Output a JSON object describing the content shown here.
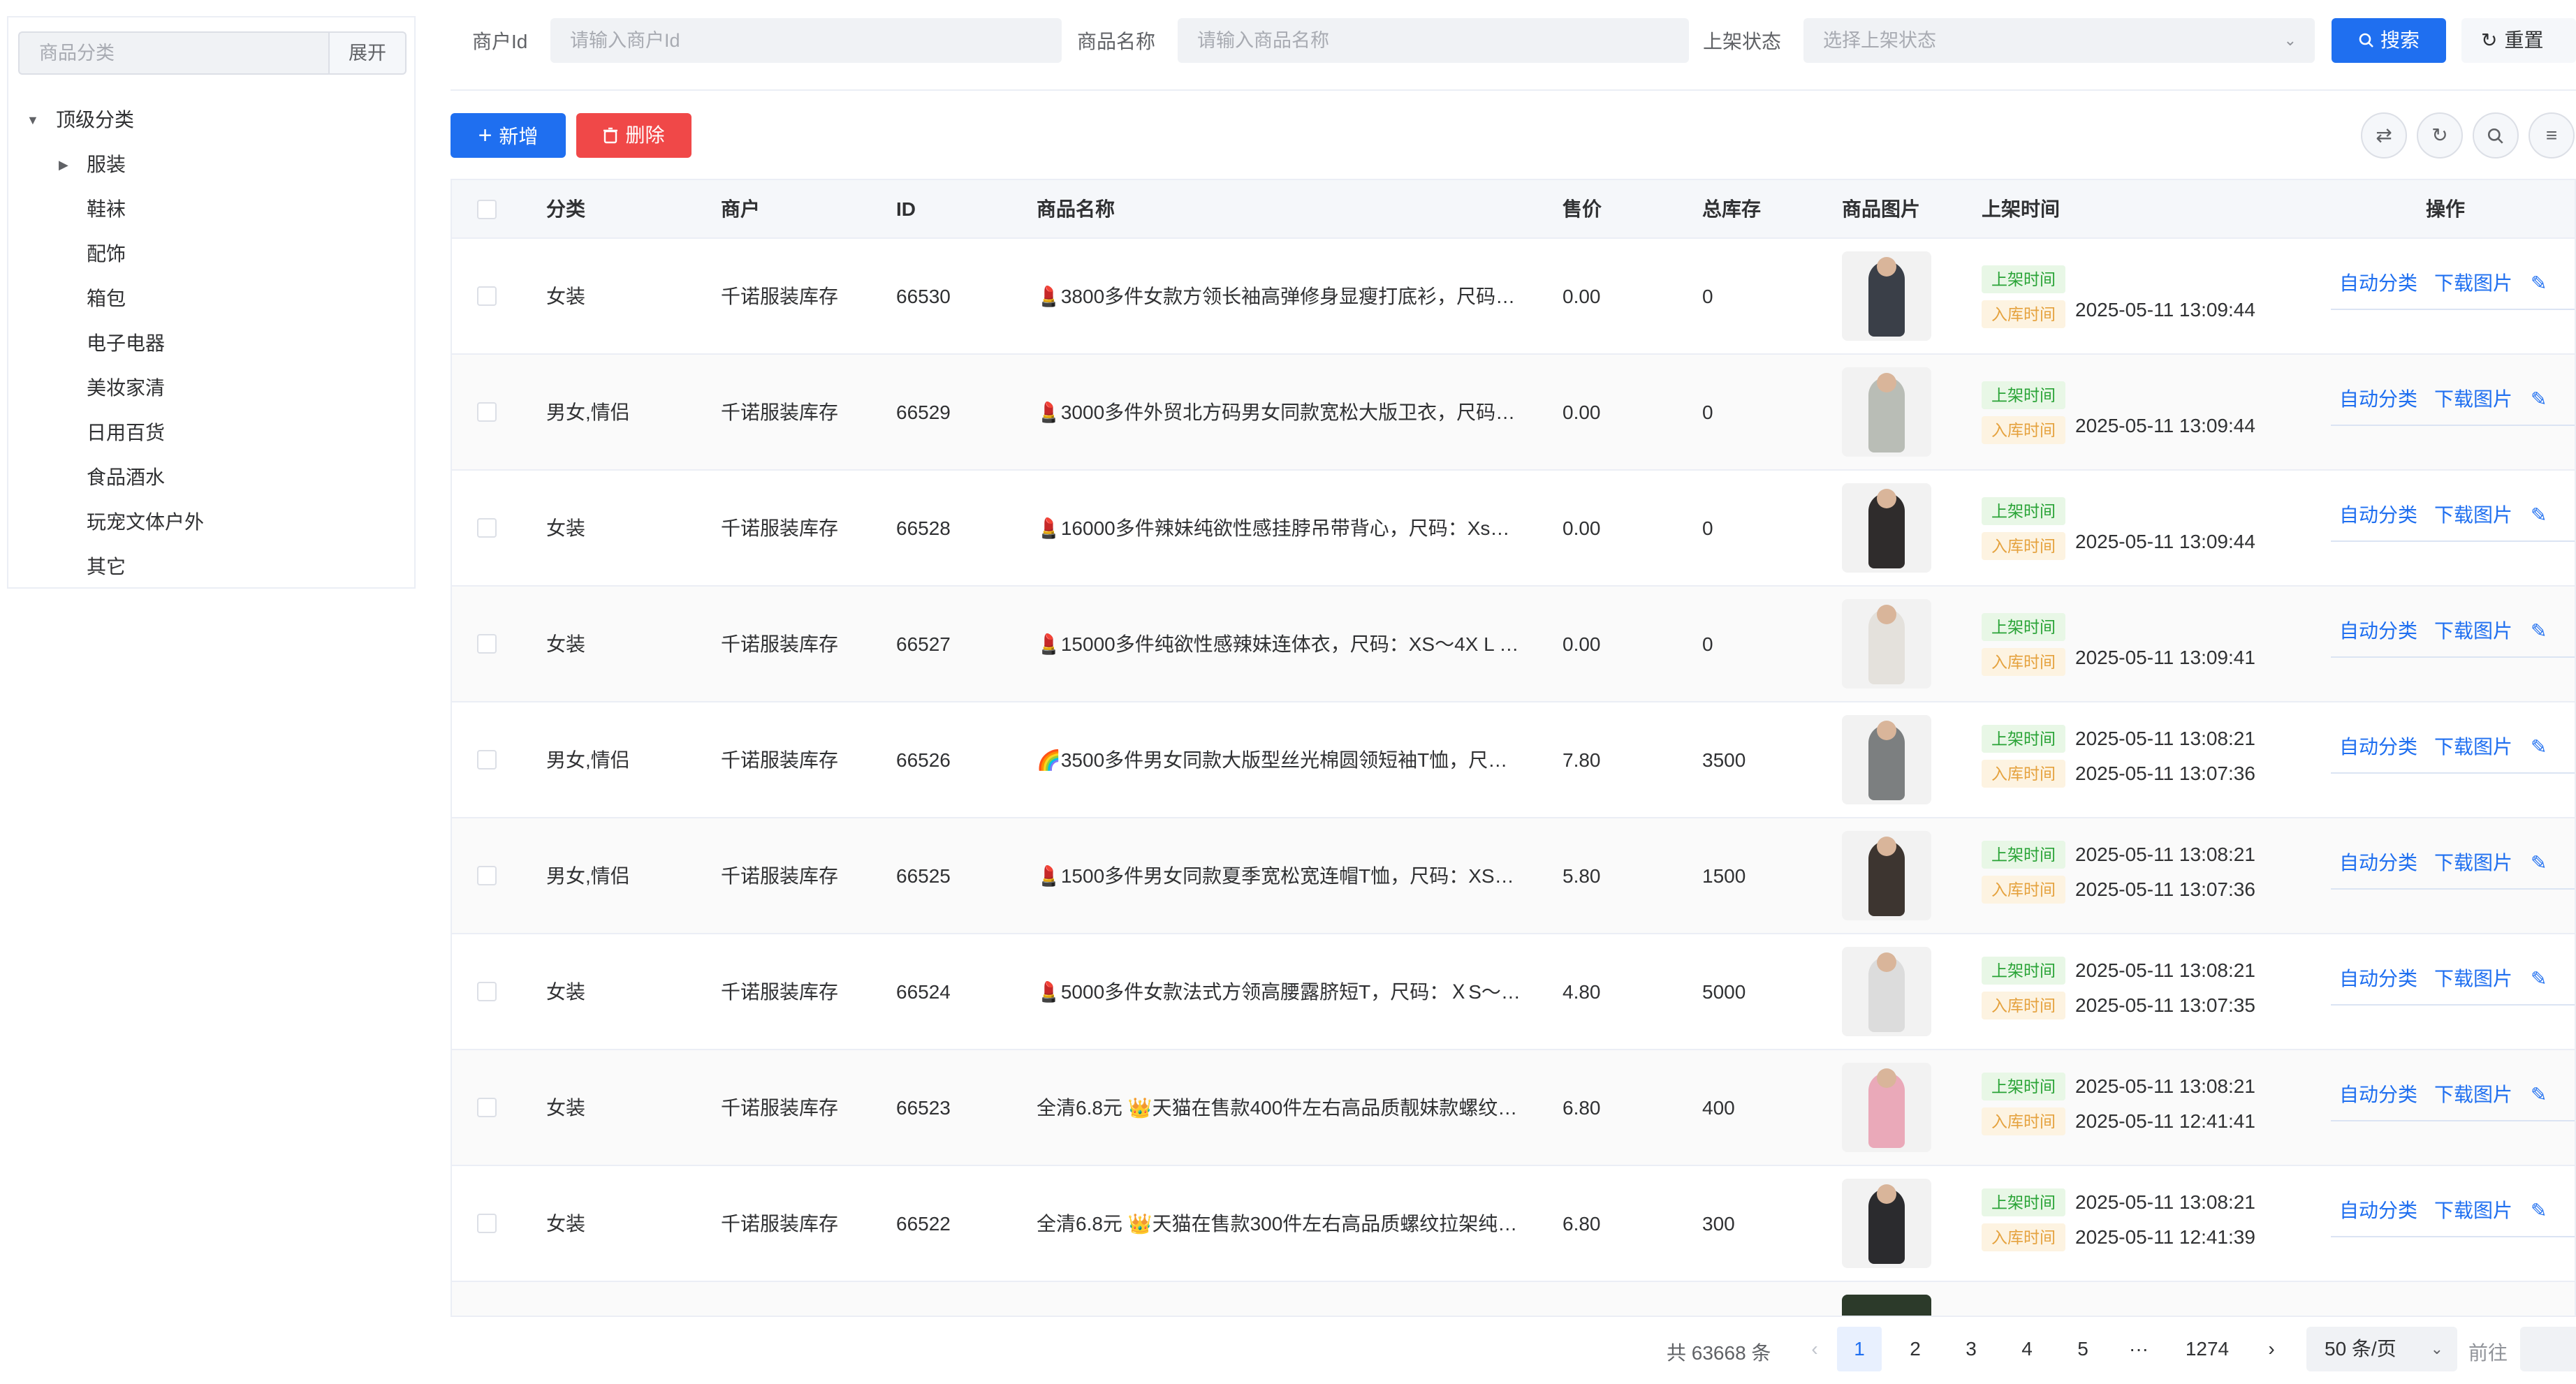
{
  "sidebar": {
    "search_placeholder": "商品分类",
    "expand_label": "展开",
    "tree": [
      {
        "label": "顶级分类",
        "level": 0,
        "expanded": true
      },
      {
        "label": "服装",
        "level": 1,
        "has_children": true
      },
      {
        "label": "鞋袜",
        "level": 1
      },
      {
        "label": "配饰",
        "level": 1
      },
      {
        "label": "箱包",
        "level": 1
      },
      {
        "label": "电子电器",
        "level": 1
      },
      {
        "label": "美妆家清",
        "level": 1
      },
      {
        "label": "日用百货",
        "level": 1
      },
      {
        "label": "食品酒水",
        "level": 1
      },
      {
        "label": "玩宠文体户外",
        "level": 1
      },
      {
        "label": "其它",
        "level": 1
      }
    ]
  },
  "filters": {
    "merchant_id_label": "商户Id",
    "merchant_id_placeholder": "请输入商户Id",
    "product_name_label": "商品名称",
    "product_name_placeholder": "请输入商品名称",
    "status_label": "上架状态",
    "status_placeholder": "选择上架状态",
    "search_label": "搜索",
    "reset_label": "重置"
  },
  "toolbar": {
    "add_label": "新增",
    "delete_label": "删除",
    "icons": [
      "swap-icon",
      "refresh-icon",
      "search-icon",
      "sort-icon"
    ]
  },
  "table": {
    "columns": [
      "分类",
      "商户",
      "ID",
      "商品名称",
      "售价",
      "总库存",
      "商品图片",
      "上架时间",
      "操作"
    ],
    "tag_on_label": "上架时间",
    "tag_in_label": "入库时间",
    "actions": [
      "自动分类",
      "下载图片"
    ],
    "rows": [
      {
        "category": "女装",
        "merchant": "千诺服装库存",
        "id": "66530",
        "name": "💄3800多件女款方领长袖高弹修身显瘦打底衫，尺码…",
        "price": "0.00",
        "stock": "0",
        "on_time": "",
        "in_time": "2025-05-11 13:09:44"
      },
      {
        "category": "男女,情侣",
        "merchant": "千诺服装库存",
        "id": "66529",
        "name": "💄3000多件外贸北方码男女同款宽松大版卫衣，尺码…",
        "price": "0.00",
        "stock": "0",
        "on_time": "",
        "in_time": "2025-05-11 13:09:44"
      },
      {
        "category": "女装",
        "merchant": "千诺服装库存",
        "id": "66528",
        "name": "💄16000多件辣妹纯欲性感挂脖吊带背心，尺码：Xs…",
        "price": "0.00",
        "stock": "0",
        "on_time": "",
        "in_time": "2025-05-11 13:09:44"
      },
      {
        "category": "女装",
        "merchant": "千诺服装库存",
        "id": "66527",
        "name": "💄15000多件纯欲性感辣妹连体衣，尺码：XS～4X L …",
        "price": "0.00",
        "stock": "0",
        "on_time": "",
        "in_time": "2025-05-11 13:09:41"
      },
      {
        "category": "男女,情侣",
        "merchant": "千诺服装库存",
        "id": "66526",
        "name": "🌈3500多件男女同款大版型丝光棉圆领短袖T恤，尺…",
        "price": "7.80",
        "stock": "3500",
        "on_time": "2025-05-11 13:08:21",
        "in_time": "2025-05-11 13:07:36"
      },
      {
        "category": "男女,情侣",
        "merchant": "千诺服装库存",
        "id": "66525",
        "name": "💄1500多件男女同款夏季宽松宽连帽T恤，尺码：XS…",
        "price": "5.80",
        "stock": "1500",
        "on_time": "2025-05-11 13:08:21",
        "in_time": "2025-05-11 13:07:36"
      },
      {
        "category": "女装",
        "merchant": "千诺服装库存",
        "id": "66524",
        "name": "💄5000多件女款法式方领高腰露脐短T，尺码：ＸS～…",
        "price": "4.80",
        "stock": "5000",
        "on_time": "2025-05-11 13:08:21",
        "in_time": "2025-05-11 13:07:35"
      },
      {
        "category": "女装",
        "merchant": "千诺服装库存",
        "id": "66523",
        "name": "全清6.8元 👑天猫在售款400件左右高品质靓妹款螺纹…",
        "price": "6.80",
        "stock": "400",
        "on_time": "2025-05-11 13:08:21",
        "in_time": "2025-05-11 12:41:41"
      },
      {
        "category": "女装",
        "merchant": "千诺服装库存",
        "id": "66522",
        "name": "全清6.8元 👑天猫在售款300件左右高品质螺纹拉架纯…",
        "price": "6.80",
        "stock": "300",
        "on_time": "2025-05-11 13:08:21",
        "in_time": "2025-05-11 12:41:39"
      }
    ],
    "thumb_colors": [
      "#3a3f48",
      "#b9bdb6",
      "#2f2c2c",
      "#e4e1dc",
      "#7c7f80",
      "#3d3530",
      "#dcdcdc",
      "#eaa9b9",
      "#2b2b2e"
    ]
  },
  "pagination": {
    "total_text": "共 63668 条",
    "pages": [
      "1",
      "2",
      "3",
      "4",
      "5",
      "···",
      "1274"
    ],
    "current_page": "1",
    "page_size": "50 条/页",
    "goto_label": "前往"
  },
  "colors": {
    "primary": "#1f6ff0",
    "danger": "#f04848",
    "success": "#29a336",
    "warning": "#e5a23e"
  }
}
